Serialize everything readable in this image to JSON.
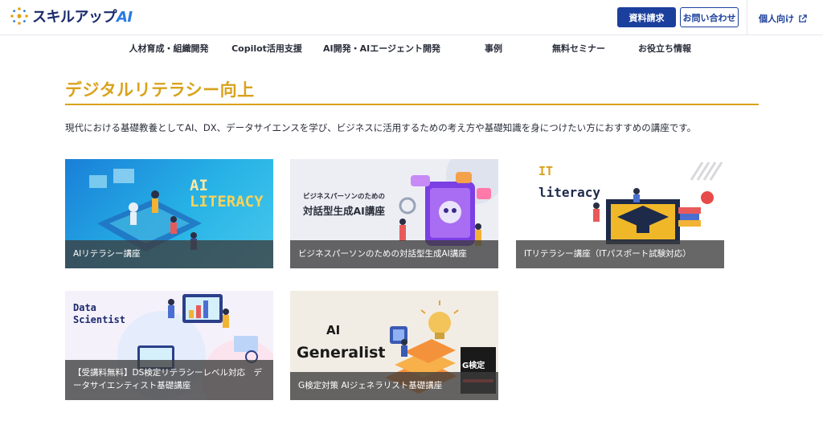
{
  "header": {
    "logo_text": "スキルアップ",
    "logo_suffix": "AI",
    "request_docs": "資料請求",
    "contact": "お問い合わせ",
    "personal": "個人向け"
  },
  "nav": {
    "items": [
      {
        "label": "人材育成・組織開発"
      },
      {
        "label": "Copilot活用支援"
      },
      {
        "label": "AI開発・AIエージェント開発"
      },
      {
        "label": "事例"
      },
      {
        "label": "無料セミナー"
      },
      {
        "label": "お役立ち情報"
      }
    ]
  },
  "section": {
    "title": "デジタルリテラシー向上",
    "description": "現代における基礎教養としてAI、DX、データサイエンスを学び、ビジネスに活用するための考え方や基礎知識を身につけたい方におすすめの講座です。"
  },
  "courses": [
    {
      "caption": "AIリテラシー講座",
      "art_line1": "AI",
      "art_line2": "LITERACY"
    },
    {
      "caption": "ビジネスパーソンのための対話型生成AI講座",
      "art_line1": "ビジネスパーソンのための",
      "art_line2": "対話型生成AI講座"
    },
    {
      "caption": "ITリテラシー講座（ITパスポート試験対応）",
      "art_line1": "IT",
      "art_line2": "literacy"
    },
    {
      "caption": "【受講料無料】DS検定リテラシーレベル対応　データサイエンティスト基礎講座",
      "art_line1": "Data",
      "art_line2": "Scientist"
    },
    {
      "caption": "G検定対策 AIジェネラリスト基礎講座",
      "art_line1": "AI",
      "art_line2": "Generalist",
      "badge": "G検定"
    }
  ],
  "colors": {
    "brand_navy": "#1b3f9c",
    "accent_gold": "#d9a21b"
  }
}
